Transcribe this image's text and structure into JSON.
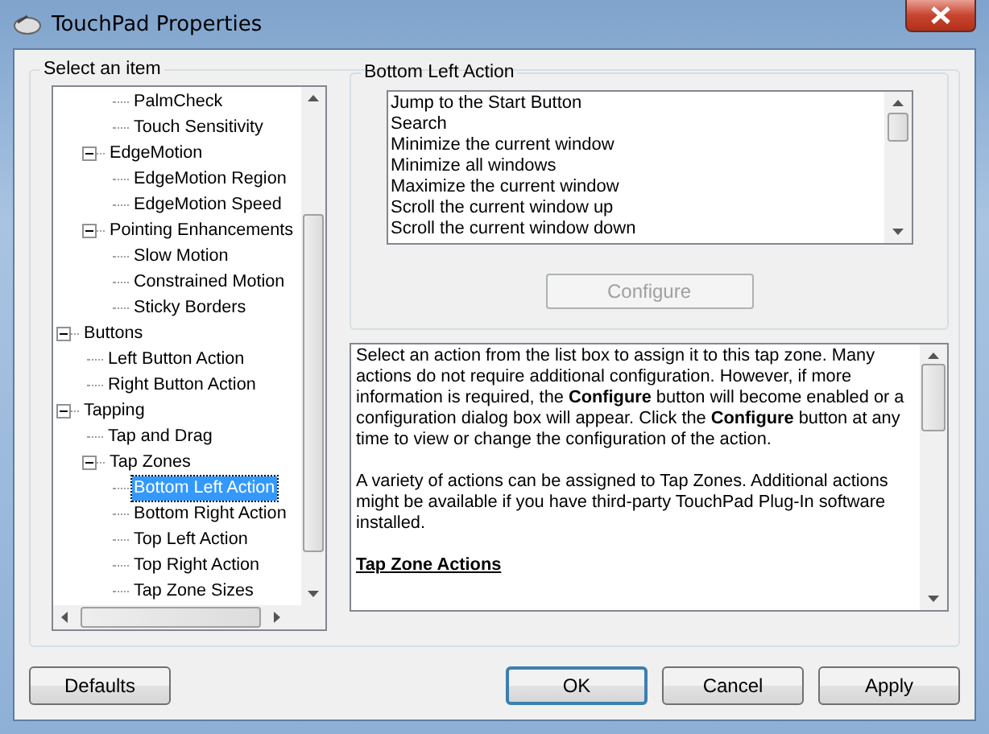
{
  "window": {
    "title": "TouchPad Properties"
  },
  "select_group": {
    "label": "Select an item"
  },
  "tree": [
    {
      "children": [
        {
          "children": [
            {
              "label": "PalmCheck",
              "selected": false
            },
            {
              "label": "Touch Sensitivity",
              "selected": false
            }
          ]
        },
        {
          "label": "EdgeMotion",
          "expanded": true,
          "selected": false,
          "children": [
            {
              "label": "EdgeMotion Region",
              "selected": false
            },
            {
              "label": "EdgeMotion Speed",
              "selected": false
            }
          ]
        },
        {
          "label": "Pointing Enhancements",
          "expanded": true,
          "selected": false,
          "children": [
            {
              "label": "Slow Motion",
              "selected": false
            },
            {
              "label": "Constrained Motion",
              "selected": false
            },
            {
              "label": "Sticky Borders",
              "selected": false
            }
          ]
        }
      ]
    },
    {
      "label": "Buttons",
      "expanded": true,
      "selected": false,
      "children": [
        {
          "label": "Left Button Action",
          "selected": false
        },
        {
          "label": "Right Button Action",
          "selected": false
        }
      ]
    },
    {
      "label": "Tapping",
      "expanded": true,
      "selected": false,
      "children": [
        {
          "label": "Tap and Drag",
          "selected": false
        },
        {
          "label": "Tap Zones",
          "expanded": true,
          "selected": false,
          "children": [
            {
              "label": "Bottom Left Action",
              "selected": true
            },
            {
              "label": "Bottom Right Action",
              "selected": false
            },
            {
              "label": "Top Left Action",
              "selected": false
            },
            {
              "label": "Top Right Action",
              "selected": false
            },
            {
              "label": "Tap Zone Sizes",
              "selected": false
            }
          ]
        }
      ]
    }
  ],
  "action_group": {
    "label": "Bottom Left Action",
    "actions": [
      {
        "label": "Jump to the Start Button",
        "selected": false
      },
      {
        "label": "Search",
        "selected": false
      },
      {
        "label": "Minimize the current window",
        "selected": false
      },
      {
        "label": "Minimize all windows",
        "selected": false
      },
      {
        "label": "Maximize the current window",
        "selected": false
      },
      {
        "label": "Scroll the current window up",
        "selected": false
      },
      {
        "label": "Scroll the current window down",
        "selected": false
      }
    ],
    "configure_button": {
      "label": "Configure",
      "disabled": true
    }
  },
  "help": [
    {
      "kind": "paragraph",
      "text": "Select an action from the list box to assign it to this tap zone. Many actions do not require additional configuration. However, if more information is required, the **Configure** button will become enabled or a configuration dialog box will appear. Click the **Configure** button at any time to view or change the configuration of the action."
    },
    {
      "kind": "paragraph",
      "text": "A variety of actions can be assigned to Tap Zones. Additional actions might be available if you have third-party TouchPad Plug-In software installed."
    },
    {
      "kind": "heading",
      "text": "Tap Zone Actions"
    }
  ],
  "buttons": {
    "defaults": "Defaults",
    "ok": "OK",
    "cancel": "Cancel",
    "apply": "Apply"
  }
}
